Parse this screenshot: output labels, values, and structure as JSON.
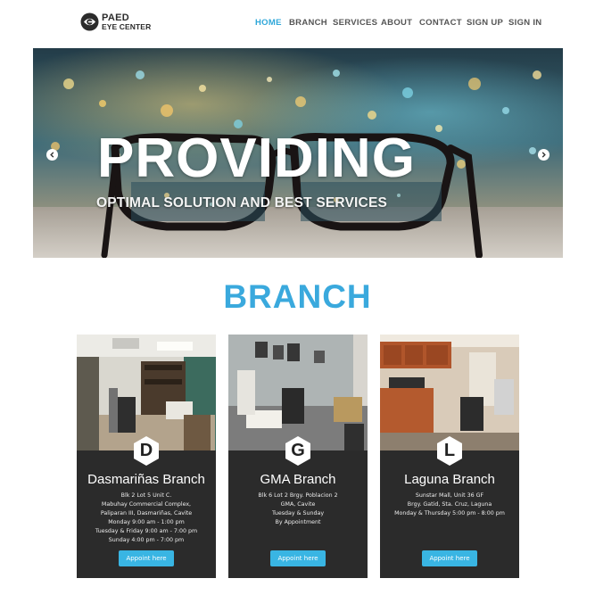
{
  "logo": {
    "line1": "PAED",
    "line2": "EYE CENTER",
    "icon": "eye-e-logo-icon"
  },
  "nav": {
    "items": [
      {
        "label": "HOME",
        "active": true
      },
      {
        "label": "BRANCH",
        "active": false
      },
      {
        "label": "SERVICES",
        "active": false
      },
      {
        "label": "ABOUT",
        "active": false
      },
      {
        "label": "CONTACT",
        "active": false
      },
      {
        "label": "SIGN UP",
        "active": false
      },
      {
        "label": "SIGN IN",
        "active": false
      }
    ],
    "active_color": "#2fa7d9"
  },
  "hero": {
    "title": "PROVIDING",
    "subtitle": "OPTIMAL SOLUTION AND BEST SERVICES",
    "prev_icon": "chevron-left-icon",
    "next_icon": "chevron-right-icon"
  },
  "branch_section": {
    "title": "BRANCH",
    "title_color": "#3aa9dd",
    "cards": [
      {
        "letter": "D",
        "name": "Dasmariñas Branch",
        "details": [
          "Blk 2 Lot 5 Unit C.",
          "Mabuhay Commercial Complex,",
          "Paliparan III, Dasmariñas, Cavite",
          "Monday 9:00 am - 1:00 pm",
          "Tuesday & Friday 9:00 am - 7:00 pm",
          "Sunday 4:00 pm - 7:00 pm"
        ],
        "button": "Appoint here"
      },
      {
        "letter": "G",
        "name": "GMA Branch",
        "details": [
          "Blk 6 Lot 2 Brgy. Poblacion 2",
          "GMA, Cavite",
          "Tuesday & Sunday",
          "By Appointment"
        ],
        "button": "Appoint here"
      },
      {
        "letter": "L",
        "name": "Laguna Branch",
        "details": [
          "Sunstar Mall, Unit 36 GF",
          "Brgy. Gatid, Sta. Cruz, Laguna",
          "Monday & Thursday 5:00 pm - 8:00 pm"
        ],
        "button": "Appoint here"
      }
    ],
    "button_color": "#39b5e3",
    "card_color": "#2b2b2b"
  }
}
